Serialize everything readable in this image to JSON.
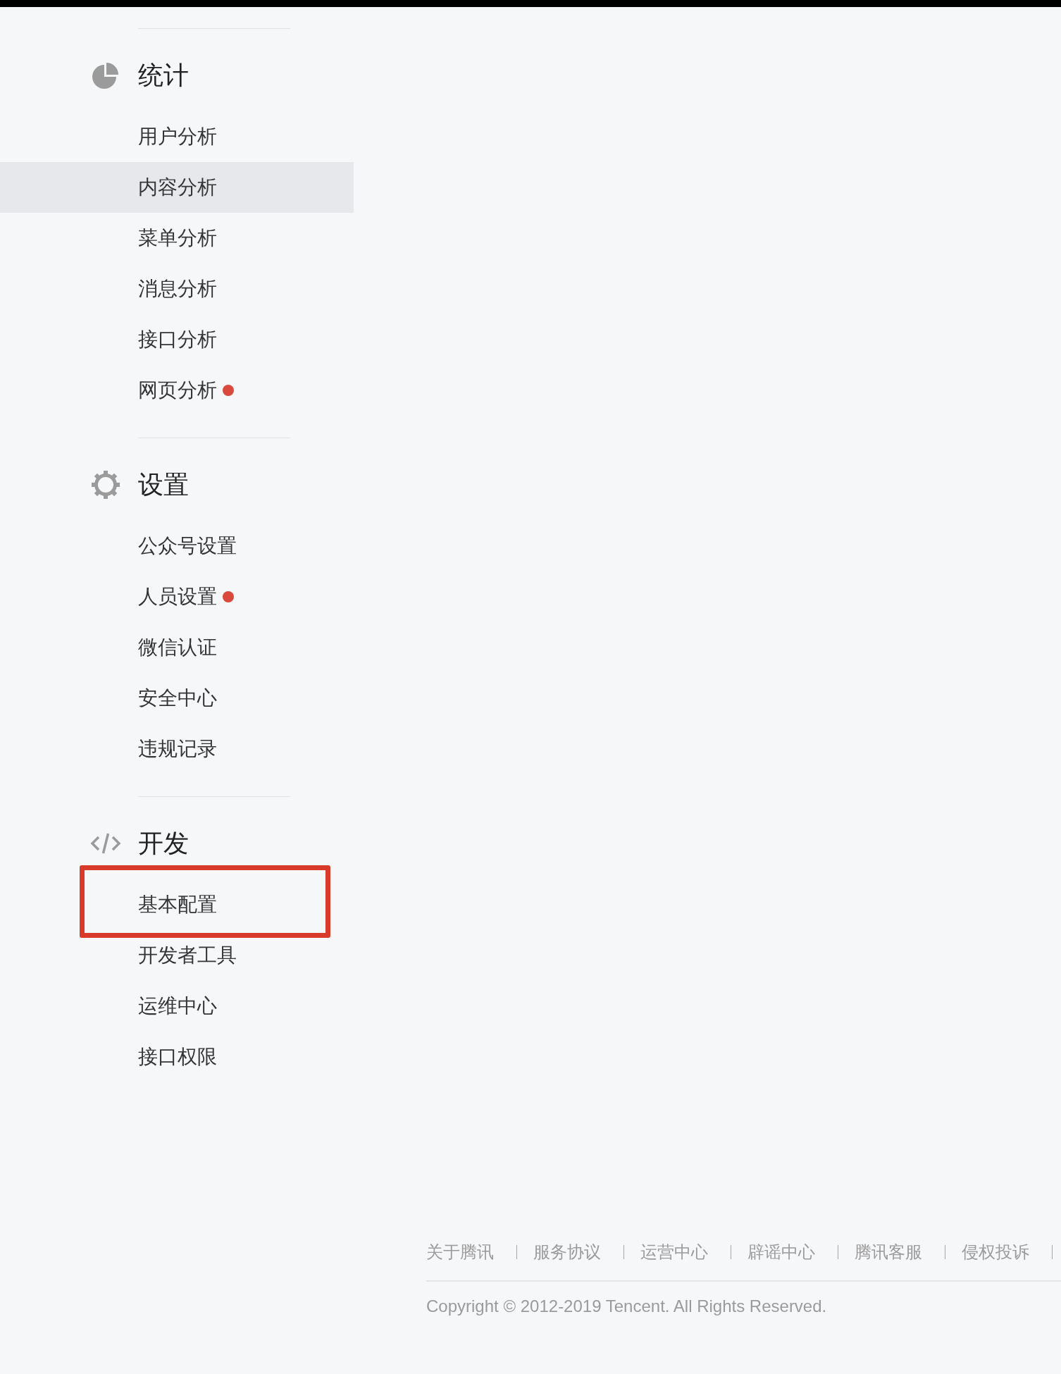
{
  "sections": [
    {
      "title": "统计",
      "items": [
        {
          "label": "用户分析",
          "selected": false,
          "notice": false,
          "outlined": false
        },
        {
          "label": "内容分析",
          "selected": true,
          "notice": false,
          "outlined": false
        },
        {
          "label": "菜单分析",
          "selected": false,
          "notice": false,
          "outlined": false
        },
        {
          "label": "消息分析",
          "selected": false,
          "notice": false,
          "outlined": false
        },
        {
          "label": "接口分析",
          "selected": false,
          "notice": false,
          "outlined": false
        },
        {
          "label": "网页分析",
          "selected": false,
          "notice": true,
          "outlined": false
        }
      ]
    },
    {
      "title": "设置",
      "items": [
        {
          "label": "公众号设置",
          "selected": false,
          "notice": false,
          "outlined": false
        },
        {
          "label": "人员设置",
          "selected": false,
          "notice": true,
          "outlined": false
        },
        {
          "label": "微信认证",
          "selected": false,
          "notice": false,
          "outlined": false
        },
        {
          "label": "安全中心",
          "selected": false,
          "notice": false,
          "outlined": false
        },
        {
          "label": "违规记录",
          "selected": false,
          "notice": false,
          "outlined": false
        }
      ]
    },
    {
      "title": "开发",
      "items": [
        {
          "label": "基本配置",
          "selected": false,
          "notice": false,
          "outlined": true
        },
        {
          "label": "开发者工具",
          "selected": false,
          "notice": false,
          "outlined": false
        },
        {
          "label": "运维中心",
          "selected": false,
          "notice": false,
          "outlined": false
        },
        {
          "label": "接口权限",
          "selected": false,
          "notice": false,
          "outlined": false
        }
      ]
    }
  ],
  "footer": {
    "links": [
      "关于腾讯",
      "服务协议",
      "运营中心",
      "辟谣中心",
      "腾讯客服",
      "侵权投诉"
    ],
    "copyright": "Copyright © 2012-2019 Tencent. All Rights Reserved."
  }
}
